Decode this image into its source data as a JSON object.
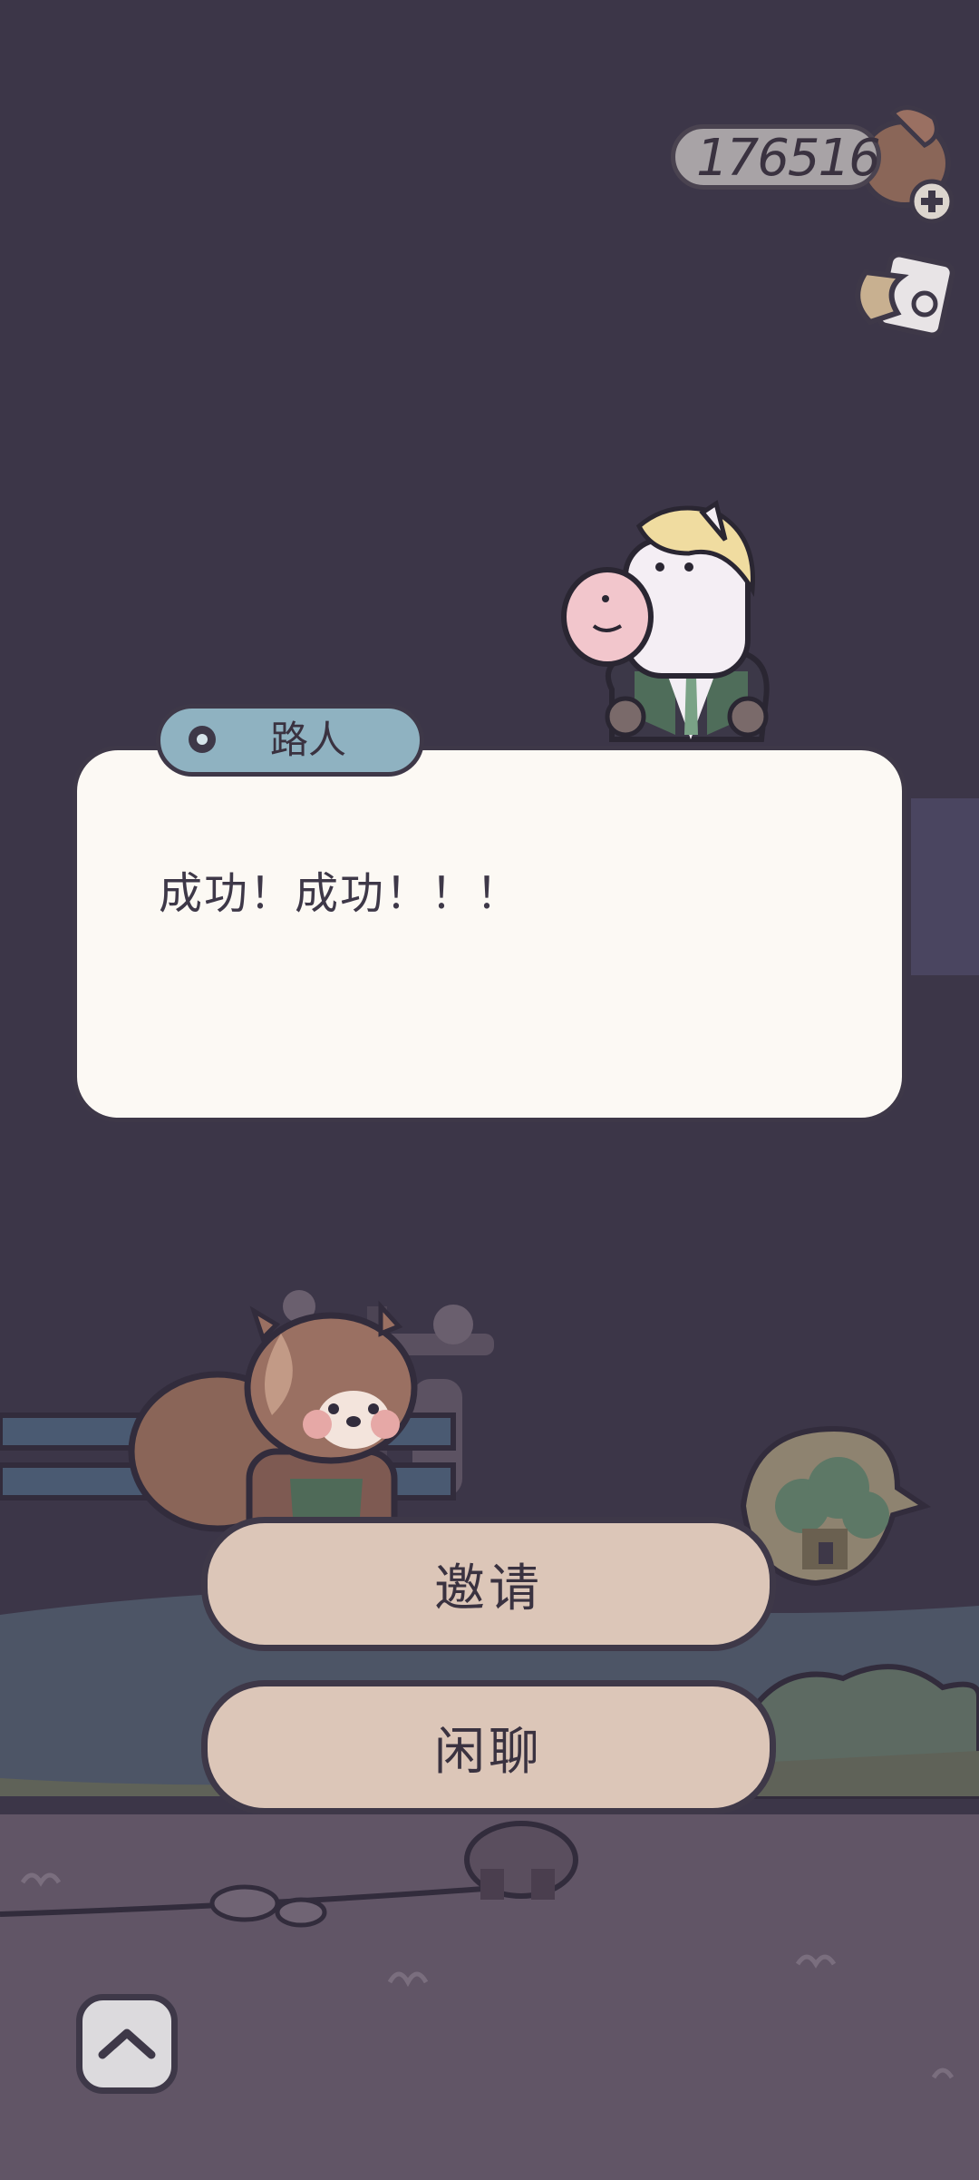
{
  "currency": {
    "value": "176516",
    "icon": "coin-bag-plus-icon"
  },
  "tools": {
    "icon": "phone-tag-icon"
  },
  "dialog": {
    "speaker": "路人",
    "text": "成功！成功！！！"
  },
  "choices": [
    {
      "label": "邀请"
    },
    {
      "label": "闲聊"
    }
  ],
  "collapse": {
    "icon": "chevron-up-icon"
  },
  "map_bubble": {
    "icon": "tree-house-bubble-icon"
  },
  "colors": {
    "background": "#3c3648",
    "dialog_bg": "#fcf9f4",
    "nametag_bg": "#8fb2c1",
    "button_bg": "#dcc6b8",
    "outline": "#3e3848"
  }
}
